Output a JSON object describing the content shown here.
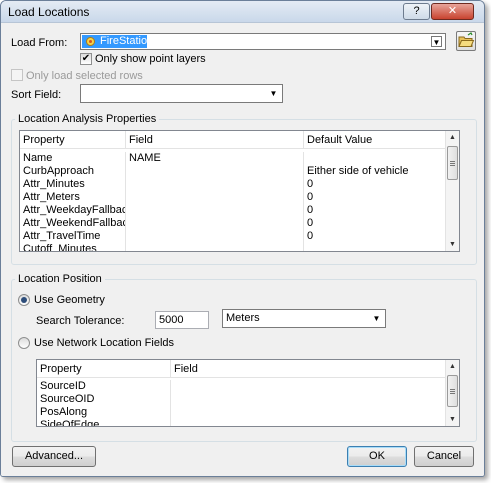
{
  "window": {
    "title": "Load Locations",
    "help_label": "?",
    "close_label": "✕"
  },
  "load_from": {
    "label": "Load From:",
    "value": "FireStations",
    "icon": "point-layer-icon"
  },
  "only_point_layers": {
    "label": "Only show point layers",
    "checked": true
  },
  "only_selected_rows": {
    "label": "Only load selected rows",
    "checked": false,
    "enabled": false
  },
  "sort_field": {
    "label": "Sort Field:",
    "value": ""
  },
  "location_analysis": {
    "title": "Location Analysis Properties",
    "columns": [
      "Property",
      "Field",
      "Default Value"
    ],
    "rows": [
      [
        "Name",
        "NAME",
        ""
      ],
      [
        "CurbApproach",
        "",
        "Either side of vehicle"
      ],
      [
        "Attr_Minutes",
        "",
        "0"
      ],
      [
        "Attr_Meters",
        "",
        "0"
      ],
      [
        "Attr_WeekdayFallback...",
        "",
        "0"
      ],
      [
        "Attr_WeekendFallback...",
        "",
        "0"
      ],
      [
        "Attr_TravelTime",
        "",
        "0"
      ],
      [
        "Cutoff_Minutes",
        "",
        ""
      ]
    ]
  },
  "location_position": {
    "title": "Location Position",
    "use_geometry": {
      "label": "Use Geometry",
      "selected": true
    },
    "search_tolerance": {
      "label": "Search Tolerance:",
      "value": "5000",
      "units": "Meters"
    },
    "use_network_fields": {
      "label": "Use Network Location Fields",
      "selected": false
    },
    "network_grid": {
      "columns": [
        "Property",
        "Field"
      ],
      "rows": [
        [
          "SourceID",
          ""
        ],
        [
          "SourceOID",
          ""
        ],
        [
          "PosAlong",
          ""
        ],
        [
          "SideOfEdge",
          ""
        ]
      ]
    }
  },
  "buttons": {
    "advanced": "Advanced...",
    "ok": "OK",
    "cancel": "Cancel"
  }
}
